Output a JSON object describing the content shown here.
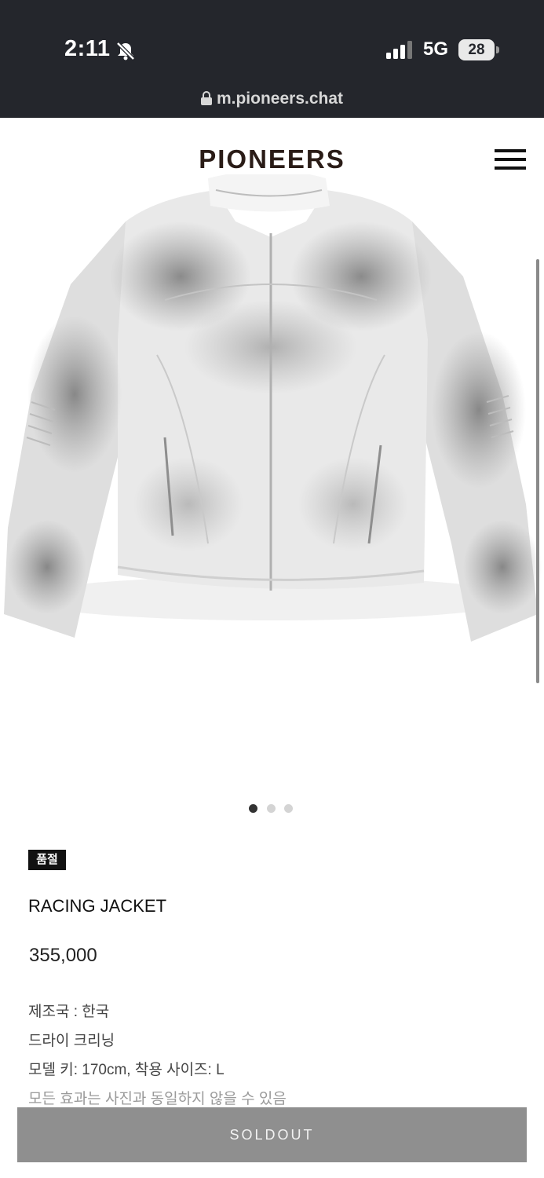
{
  "status_bar": {
    "time": "2:11",
    "network": "5G",
    "battery": "28",
    "icons": [
      "bell-slash-icon",
      "cellular-signal-icon"
    ]
  },
  "browser": {
    "url": "m.pioneers.chat"
  },
  "header": {
    "logo": "PIONEERS"
  },
  "carousel": {
    "slide_count": 3,
    "active_index": 0
  },
  "product": {
    "badge": "품절",
    "name": "RACING JACKET",
    "price": "355,000",
    "details": [
      "제조국 : 한국",
      "드라이 크리닝",
      "모델 키: 170cm, 착용 사이즈: L",
      "모든 효과는 사진과 동일하지 않을 수 있음"
    ]
  },
  "actions": {
    "soldout_label": "SOLDOUT"
  },
  "colors": {
    "status_bar_bg": "#24262c",
    "button_bg": "#8f8f8f",
    "badge_bg": "#111111"
  }
}
